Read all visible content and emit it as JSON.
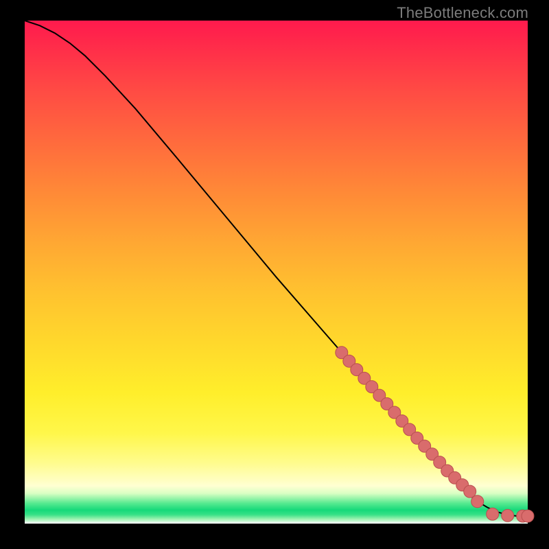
{
  "attribution": "TheBottleneck.com",
  "colors": {
    "marker_fill": "#d96c6c",
    "marker_stroke": "#b94f4f",
    "curve": "#000000"
  },
  "chart_data": {
    "type": "line",
    "title": "",
    "xlabel": "",
    "ylabel": "",
    "xlim": [
      0,
      100
    ],
    "ylim": [
      0,
      100
    ],
    "grid": false,
    "series": [
      {
        "name": "curve",
        "style": "line",
        "x": [
          0,
          3,
          6,
          9,
          12,
          16,
          22,
          30,
          40,
          50,
          60,
          70,
          78,
          84,
          88,
          90,
          92,
          94,
          96,
          98,
          100
        ],
        "y": [
          100,
          99,
          97.5,
          95.5,
          93,
          89,
          82.5,
          73,
          61,
          49,
          37.5,
          26,
          17,
          10.5,
          6,
          4.4,
          3.2,
          2.3,
          1.7,
          1.5,
          1.5
        ]
      },
      {
        "name": "highlighted-points",
        "style": "markers",
        "x": [
          63,
          64.5,
          66,
          67.5,
          69,
          70.5,
          72,
          73.5,
          75,
          76.5,
          78,
          79.5,
          81,
          82.5,
          84,
          85.5,
          87,
          88.5,
          90,
          93,
          96,
          99,
          100
        ],
        "y": [
          34,
          32.3,
          30.6,
          28.9,
          27.2,
          25.5,
          23.8,
          22.1,
          20.4,
          18.7,
          17,
          15.4,
          13.8,
          12.2,
          10.5,
          9.1,
          7.7,
          6.4,
          4.4,
          1.9,
          1.6,
          1.5,
          1.5
        ]
      }
    ]
  }
}
